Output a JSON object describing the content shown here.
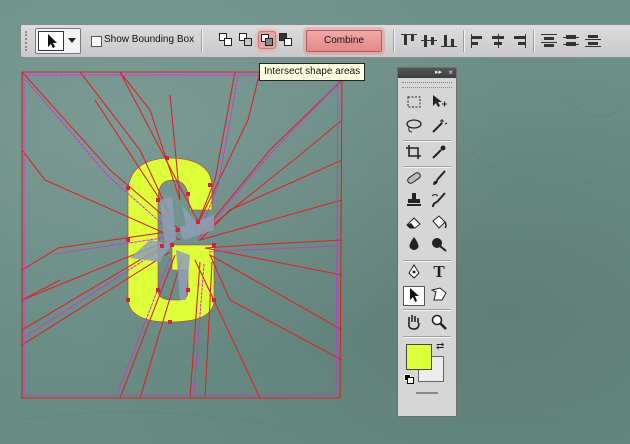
{
  "options_bar": {
    "show_bounding_box_label": "Show Bounding Box",
    "show_bounding_box_checked": false,
    "combine_label": "Combine",
    "active_mode": "intersect"
  },
  "tooltip": {
    "text": "Intersect shape areas"
  },
  "tools_panel": {
    "collapse_glyph": "▸▸",
    "close_glyph": "×",
    "tools": [
      [
        "marquee-icon",
        "move-icon"
      ],
      [
        "lasso-icon",
        "magic-wand-icon"
      ],
      [
        "crop-icon",
        "eyedropper-icon"
      ],
      [
        "healing-brush-icon",
        "brush-icon"
      ],
      [
        "clone-stamp-icon",
        "history-brush-icon"
      ],
      [
        "eraser-icon",
        "paint-bucket-icon"
      ],
      [
        "blur-icon",
        "burn-icon"
      ],
      [
        "pen-icon",
        "type-icon"
      ],
      [
        "path-selection-icon",
        "custom-shape-icon"
      ],
      [
        "hand-icon",
        "zoom-icon"
      ]
    ],
    "active_tool": "path-selection-icon",
    "type_glyph": "T"
  },
  "colors": {
    "foreground": "#ddff3a",
    "background": "#ededed",
    "path_red": "#d4262a",
    "path_magenta": "#cf2fd0",
    "shape_fill": "#ddff3a",
    "combine_highlight": "#e48787"
  }
}
